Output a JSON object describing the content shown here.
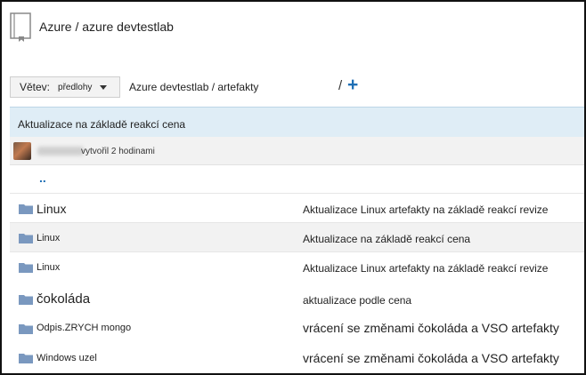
{
  "header": {
    "title": "Azure / azure devtestlab"
  },
  "toolbar": {
    "branch_label": "Větev:",
    "branch_value": "předlohy",
    "path": "Azure devtestlab / artefakty",
    "separator": "/",
    "add_label": "+"
  },
  "commit": {
    "message": "Aktualizace na základě reakcí cena",
    "time": "vytvořil 2 hodinami"
  },
  "parent_link": "..",
  "files": [
    {
      "name": "Linux",
      "message": "Aktualizace Linux artefakty na základě reakcí revize"
    },
    {
      "name": "Linux",
      "message": "Aktualizace na základě reakcí cena"
    },
    {
      "name": "Linux",
      "message": "Aktualizace Linux artefakty na základě reakcí revize"
    },
    {
      "name": "čokoláda",
      "message": "aktualizace podle cena"
    },
    {
      "name": "Odpis.ZRYCH mongo",
      "message": "vrácení se změnami čokoláda a VSO artefakty"
    },
    {
      "name": "Windows uzel",
      "message": "vrácení se změnami čokoláda a VSO artefakty"
    }
  ],
  "colors": {
    "accent": "#1f6fb5",
    "folder": "#7a98bf",
    "commit_bg": "#dfedf6"
  },
  "icons": {
    "repo": "repo-icon",
    "folder": "folder-icon",
    "add": "plus-icon",
    "dropdown": "chevron-down-icon"
  }
}
